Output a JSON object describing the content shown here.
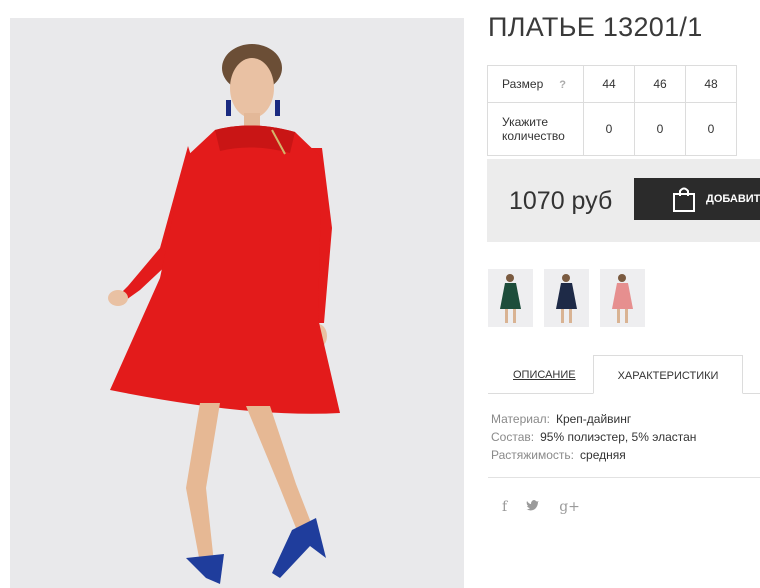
{
  "product": {
    "title": "ПЛАТЬЕ 13201/1",
    "image_alt": "red-dress-model-photo"
  },
  "sizes": {
    "row_label": "Размер",
    "help": "?",
    "values": [
      "44",
      "46",
      "48"
    ],
    "qty_label": "Укажите количество",
    "quantities": [
      "0",
      "0",
      "0"
    ]
  },
  "purchase": {
    "price": "1070 руб",
    "add_button": "ДОБАВИТ"
  },
  "thumbnails": [
    {
      "name": "green",
      "color": "#1d4d3b"
    },
    {
      "name": "navy",
      "color": "#1e2a47"
    },
    {
      "name": "pink",
      "color": "#e68f8f"
    }
  ],
  "tabs": [
    {
      "label": "ОПИСАНИЕ",
      "active": false
    },
    {
      "label": "ХАРАКТЕРИСТИКИ",
      "active": true
    }
  ],
  "specs": [
    {
      "key": "Материал:",
      "value": "Креп-дайвинг"
    },
    {
      "key": "Состав:",
      "value": "95% полиэстер, 5% эластан"
    },
    {
      "key": "Растяжимость:",
      "value": "средняя"
    }
  ],
  "social": [
    "f",
    "twitter-icon",
    "g+"
  ],
  "colors": {
    "dress": "#e31b1b",
    "button": "#2b2b2b",
    "price_bg": "#ececec"
  }
}
